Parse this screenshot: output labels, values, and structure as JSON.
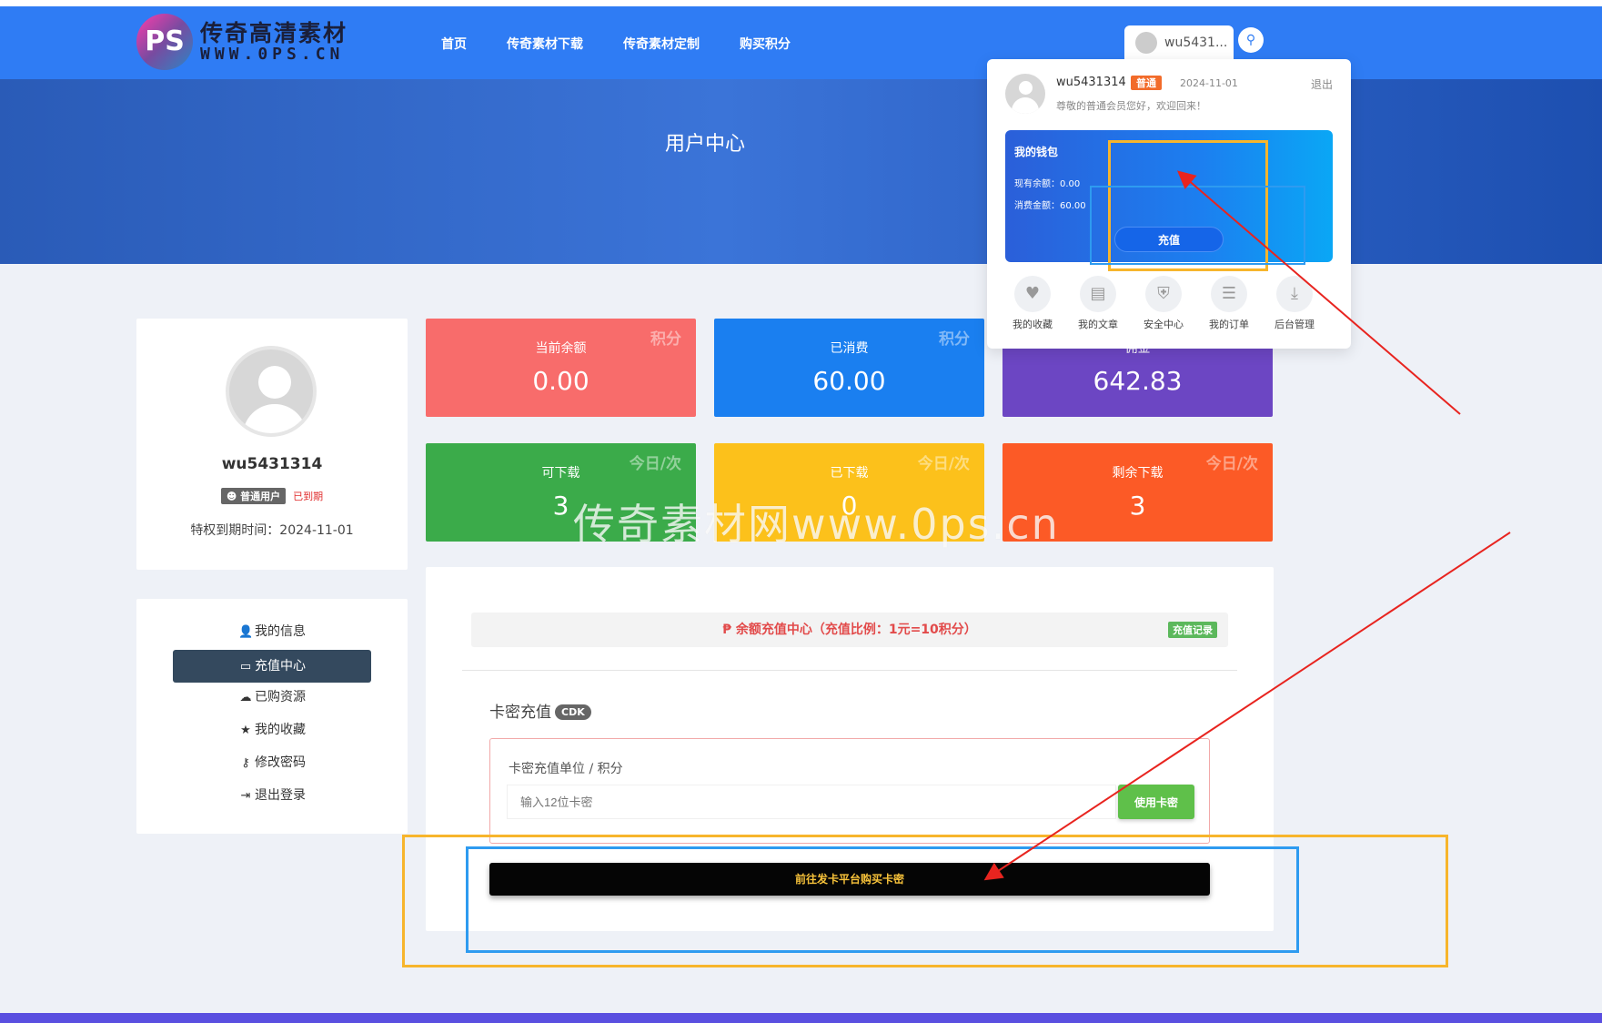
{
  "header": {
    "logo_badge": "PS",
    "logo_title": "传奇高清素材",
    "logo_url": "WWW.0PS.CN",
    "nav": [
      "首页",
      "传奇素材下载",
      "传奇素材定制",
      "购买积分"
    ],
    "user_short": "wu5431...",
    "search_icon": "search-icon"
  },
  "banner": {
    "title": "用户中心"
  },
  "profile": {
    "username": "wu5431314",
    "role": "普通用户",
    "status": "已到期",
    "expire": "特权到期时间：2024-11-01"
  },
  "menu": {
    "items": [
      {
        "label": "我的信息",
        "icon": "👤"
      },
      {
        "label": "充值中心",
        "icon": "▭"
      },
      {
        "label": "已购资源",
        "icon": "☁"
      },
      {
        "label": "我的收藏",
        "icon": "★"
      },
      {
        "label": "修改密码",
        "icon": "⚷"
      },
      {
        "label": "退出登录",
        "icon": "⇥"
      }
    ]
  },
  "stats": [
    {
      "label": "当前余额",
      "value": "0.00",
      "tag": "积分",
      "color": "#f86c6b"
    },
    {
      "label": "已消费",
      "value": "60.00",
      "tag": "积分",
      "color": "#1a7ff0"
    },
    {
      "label": "佣金",
      "value": "642.83",
      "tag": "",
      "color": "#6c46c3"
    },
    {
      "label": "可下载",
      "value": "3",
      "tag": "今日/次",
      "color": "#3bab4a"
    },
    {
      "label": "已下载",
      "value": "0",
      "tag": "今日/次",
      "color": "#fcc11b"
    },
    {
      "label": "剩余下载",
      "value": "3",
      "tag": "今日/次",
      "color": "#fc5a26"
    }
  ],
  "recharge": {
    "bar_text": "余额充值中心（充值比例：1元=10积分）",
    "record_label": "充值记录",
    "cdk_title": "卡密充值",
    "cdk_pill": "CDK",
    "cdk_label": "卡密充值单位 / 积分",
    "cdk_placeholder": "输入12位卡密",
    "cdk_button": "使用卡密",
    "buy_button": "前往发卡平台购买卡密"
  },
  "dropdown": {
    "name": "wu5431314",
    "level": "普通",
    "date": "2024-11-01",
    "logout": "退出",
    "welcome": "尊敬的普通会员您好，欢迎回来！",
    "wallet_title": "我的钱包",
    "balance": "现有余额：0.00",
    "spent": "消费金额：60.00",
    "wallet_button": "充值",
    "quick_links": [
      {
        "label": "我的收藏",
        "icon": "♥"
      },
      {
        "label": "我的文章",
        "icon": "▤"
      },
      {
        "label": "安全中心",
        "icon": "⛨"
      },
      {
        "label": "我的订单",
        "icon": "☰"
      },
      {
        "label": "后台管理",
        "icon": "⤓"
      }
    ]
  },
  "watermark": "传奇素材网www.0ps.cn",
  "colors": {
    "header": "#2f7cf4",
    "active_menu": "#34495e",
    "annotation_orange": "#f7b52c",
    "annotation_blue": "#2e9bf0",
    "annotation_red": "#e8241f"
  }
}
